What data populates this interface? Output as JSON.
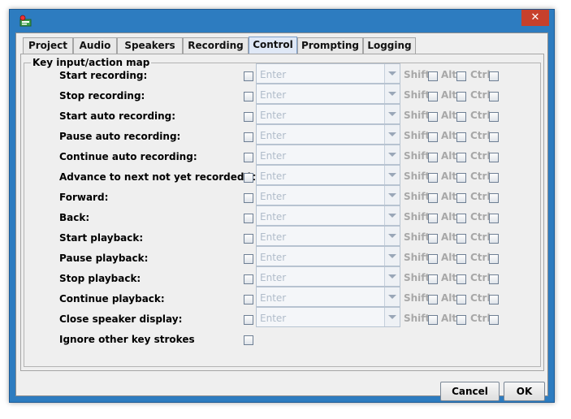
{
  "window": {
    "close_glyph": "✕",
    "icon": "app-icon"
  },
  "tabs": [
    {
      "label": "Project",
      "selected": false
    },
    {
      "label": "Audio",
      "selected": false
    },
    {
      "label": "Speakers",
      "selected": false
    },
    {
      "label": "Recording",
      "selected": false
    },
    {
      "label": "Control",
      "selected": true
    },
    {
      "label": "Prompting",
      "selected": false
    },
    {
      "label": "Logging",
      "selected": false
    }
  ],
  "group": {
    "title": "Key input/action map"
  },
  "combo_placeholder": "Enter",
  "modifiers": {
    "shift": "Shift",
    "alt": "Alt",
    "ctrl": "Ctrl"
  },
  "actions": [
    {
      "label": "Start recording:"
    },
    {
      "label": "Stop recording:"
    },
    {
      "label": "Start auto recording:"
    },
    {
      "label": "Pause auto recording:"
    },
    {
      "label": "Continue auto recording:"
    },
    {
      "label": "Advance to next not yet recorded item:"
    },
    {
      "label": "Forward:"
    },
    {
      "label": "Back:"
    },
    {
      "label": "Start playback:"
    },
    {
      "label": "Pause playback:"
    },
    {
      "label": "Stop playback:"
    },
    {
      "label": "Continue playback:"
    },
    {
      "label": "Close speaker display:"
    }
  ],
  "ignore": {
    "label": "Ignore other key strokes"
  },
  "buttons": {
    "cancel": "Cancel",
    "ok": "OK"
  },
  "colors": {
    "title_bar": "#2d7cc0",
    "close_button": "#c7402c",
    "selected_tab": "#dfe8f6"
  }
}
